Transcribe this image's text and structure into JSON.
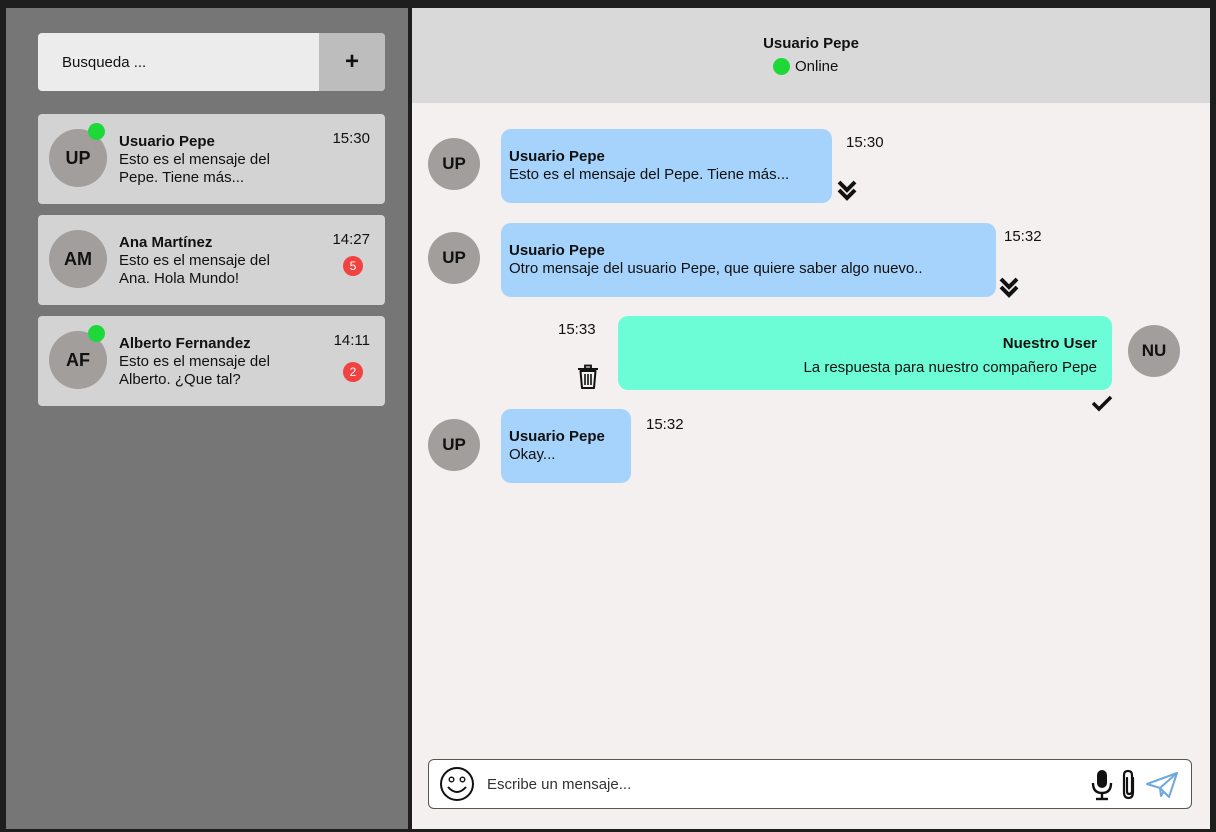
{
  "sidebar": {
    "search": {
      "placeholder": "Busqueda ...",
      "add_label": "+"
    },
    "conversations": [
      {
        "initials": "UP",
        "name": "Usuario Pepe",
        "preview": "Esto es el mensaje del Pepe. Tiene más...",
        "time": "15:30",
        "online": true,
        "unread": ""
      },
      {
        "initials": "AM",
        "name": "Ana Martínez",
        "preview": "Esto es el mensaje del Ana. Hola Mundo!",
        "time": "14:27",
        "online": false,
        "unread": "5"
      },
      {
        "initials": "AF",
        "name": "Alberto Fernandez",
        "preview": "Esto es el mensaje del Alberto. ¿Que tal?",
        "time": "14:11",
        "online": true,
        "unread": "2"
      }
    ]
  },
  "chat": {
    "header": {
      "name": "Usuario Pepe",
      "status": "Online"
    },
    "messages": [
      {
        "initials": "UP",
        "author": "Usuario Pepe",
        "text": "Esto es el mensaje del Pepe. Tiene más...",
        "time": "15:30",
        "status": "read"
      },
      {
        "initials": "UP",
        "author": "Usuario Pepe",
        "text": "Otro mensaje del usuario Pepe, que quiere saber algo nuevo..",
        "time": "15:32",
        "status": "read"
      },
      {
        "initials": "NU",
        "author": "Nuestro User",
        "text": "La respuesta para nuestro compañero Pepe",
        "time": "15:33",
        "status": "sent"
      },
      {
        "initials": "UP",
        "author": "Usuario Pepe",
        "text": "Okay...",
        "time": "15:32",
        "status": ""
      }
    ],
    "composer": {
      "placeholder": "Escribe un mensaje..."
    }
  },
  "colors": {
    "sidebar_bg": "#767676",
    "card_bg": "#d3d3d3",
    "chat_bg": "#f4f0ef",
    "incoming_bubble": "#a6d3fb",
    "outgoing_bubble": "#6cfdd7",
    "online": "#1ed83a",
    "badge": "#f24141",
    "send_icon": "#6fa8dc"
  },
  "icons": [
    "plus-icon",
    "online-dot-icon",
    "double-check-icon",
    "check-icon",
    "trash-icon",
    "emoji-icon",
    "microphone-icon",
    "paperclip-icon",
    "send-icon"
  ]
}
